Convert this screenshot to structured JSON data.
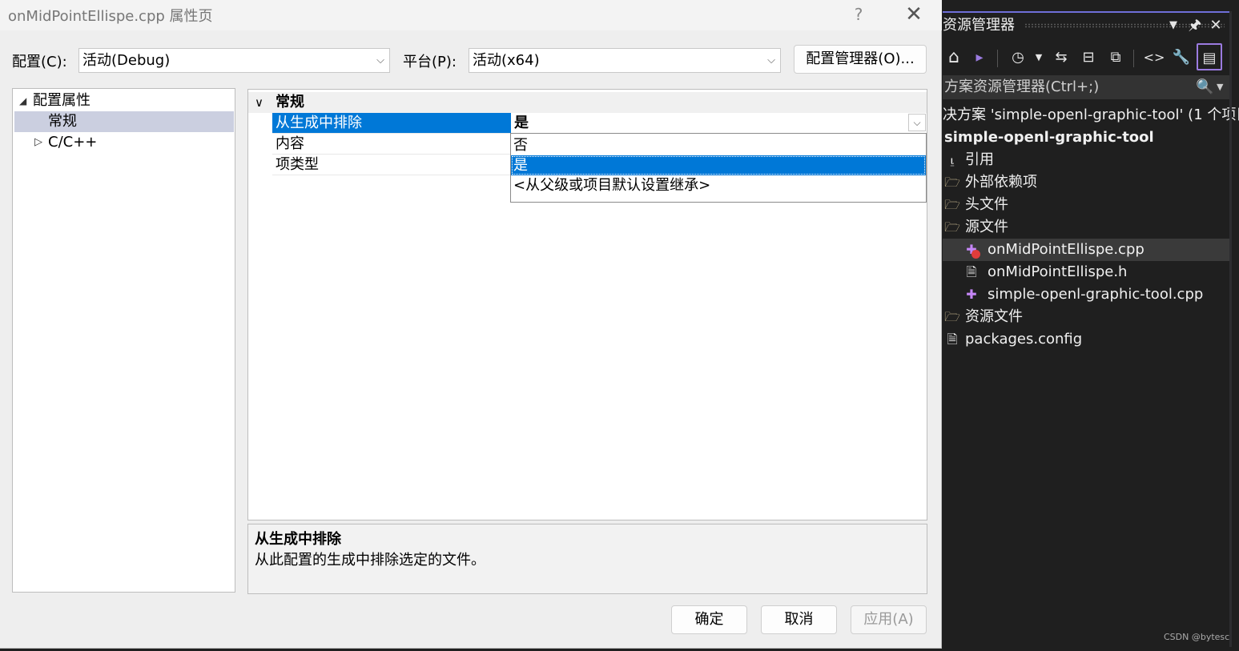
{
  "dialog": {
    "title": "onMidPointEllispe.cpp 属性页",
    "help_label": "?",
    "close_label": "✕",
    "config_label": "配置(C):",
    "config_value": "活动(Debug)",
    "platform_label": "平台(P):",
    "platform_value": "活动(x64)",
    "config_manager_label": "配置管理器(O)...",
    "tree": {
      "root_label": "配置属性",
      "items": [
        {
          "label": "常规",
          "selected": true
        },
        {
          "label": "C/C++",
          "selected": false
        }
      ]
    },
    "grid": {
      "category": "常规",
      "rows": [
        {
          "name": "从生成中排除",
          "value": "是",
          "selected": true
        },
        {
          "name": "内容",
          "value": ""
        },
        {
          "name": "项类型",
          "value": ""
        }
      ],
      "dropdown_options": [
        "否",
        "是",
        "<从父级或项目默认设置继承>"
      ],
      "dropdown_selected": "是"
    },
    "description": {
      "title": "从生成中排除",
      "text": "从此配置的生成中排除选定的文件。"
    },
    "buttons": {
      "ok": "确定",
      "cancel": "取消",
      "apply": "应用(A)"
    }
  },
  "solution_explorer": {
    "title": "资源管理器",
    "search_placeholder": "方案资源管理器(Ctrl+;)",
    "solution_label": "决方案 'simple-openl-graphic-tool' (1 个项目",
    "project_label": "simple-openl-graphic-tool",
    "items": [
      {
        "label": "引用",
        "icon": "references-icon"
      },
      {
        "label": "外部依赖项",
        "icon": "external-deps-icon"
      },
      {
        "label": "头文件",
        "icon": "filter-folder-icon"
      },
      {
        "label": "源文件",
        "icon": "filter-folder-icon"
      },
      {
        "label": "onMidPointEllispe.cpp",
        "icon": "cpp-excluded-icon"
      },
      {
        "label": "onMidPointEllispe.h",
        "icon": "header-file-icon"
      },
      {
        "label": "simple-openl-graphic-tool.cpp",
        "icon": "cpp-file-icon"
      },
      {
        "label": "资源文件",
        "icon": "filter-folder-icon"
      },
      {
        "label": "packages.config",
        "icon": "config-file-icon"
      }
    ],
    "watermark": "CSDN @bytesc"
  },
  "colors": {
    "selection_blue": "#0078d7",
    "tree_selected": "#cbcfe0",
    "dark_bg": "#1f1f1f",
    "accent_purple": "#9b7be0"
  }
}
